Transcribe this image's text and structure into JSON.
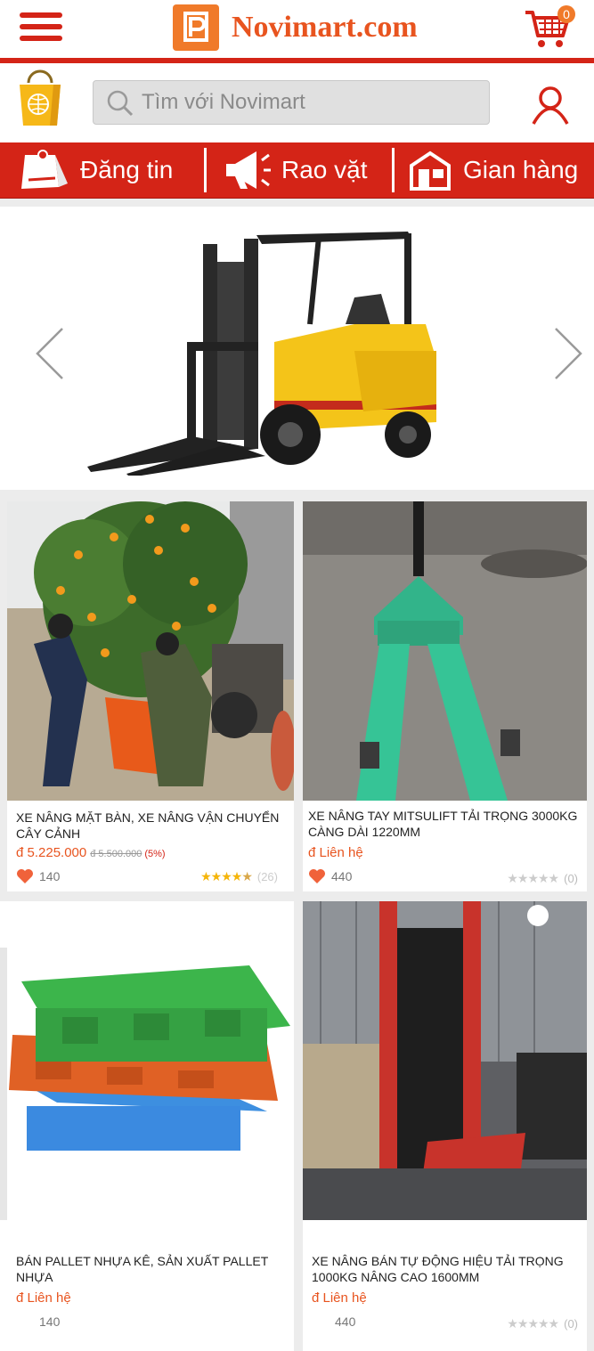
{
  "header": {
    "logo_text": "Novimart.com",
    "cart_count": "0"
  },
  "search": {
    "placeholder": "Tìm với Novimart"
  },
  "nav": {
    "items": [
      {
        "label": "Đăng tin",
        "icon": "post-icon"
      },
      {
        "label": "Rao vặt",
        "icon": "megaphone-icon"
      },
      {
        "label": "Gian hàng",
        "icon": "store-icon"
      }
    ]
  },
  "banner": {
    "image": "forklift-photo"
  },
  "products": [
    {
      "name": "XE NÂNG MẶT BÀN, XE NÂNG VẬN CHUYỂN CÂY CẢNH",
      "price": "đ 5.225.000",
      "old_price": "đ 5.500.000",
      "discount": "(5%)",
      "likes": "140",
      "rating_count": "(26)",
      "rating_stars": 4.5
    },
    {
      "name": "XE NÂNG TAY MITSULIFT TẢI TRỌNG 3000KG CÀNG DÀI 1220MM",
      "price": "đ Liên hệ",
      "likes": "440",
      "rating_count": "(0)",
      "rating_stars": 0
    },
    {
      "name": "BÁN PALLET NHỰA KÊ, SẢN XUẤT PALLET NHỰA",
      "price": "đ Liên hệ",
      "likes": "140"
    },
    {
      "name": "XE NÂNG BÁN TỰ ĐỘNG HIỆU TẢI TRỌNG 1000KG NÂNG CAO 1600MM",
      "price": "đ Liên hệ",
      "likes": "440",
      "rating_count": "(0)",
      "rating_stars": 0
    }
  ],
  "colors": {
    "brand_red": "#d42417",
    "brand_orange": "#f07a2a",
    "price": "#e8541f"
  }
}
